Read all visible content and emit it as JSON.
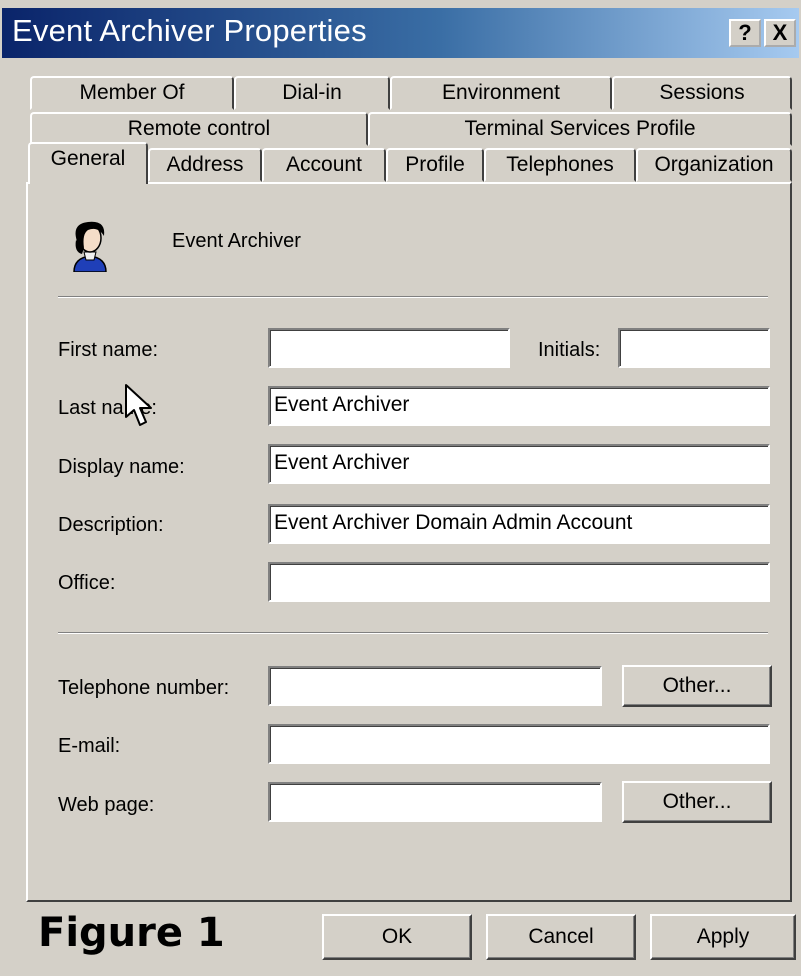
{
  "window": {
    "title": "Event Archiver Properties",
    "help_label": "?",
    "close_label": "X"
  },
  "tabs": {
    "row1": [
      "Member Of",
      "Dial-in",
      "Environment",
      "Sessions"
    ],
    "row2": [
      "Remote control",
      "Terminal Services Profile"
    ],
    "row3": [
      "General",
      "Address",
      "Account",
      "Profile",
      "Telephones",
      "Organization"
    ],
    "selected": "General"
  },
  "general": {
    "display_heading": "Event Archiver",
    "first_name_label": "First name:",
    "first_name_value": "",
    "initials_label": "Initials:",
    "initials_value": "",
    "last_name_label": "Last name:",
    "last_name_value": "Event Archiver",
    "display_name_label": "Display name:",
    "display_name_value": "Event Archiver",
    "description_label": "Description:",
    "description_value": "Event Archiver Domain Admin Account",
    "office_label": "Office:",
    "office_value": "",
    "telephone_label": "Telephone number:",
    "telephone_value": "",
    "email_label": "E-mail:",
    "email_value": "",
    "webpage_label": "Web page:",
    "webpage_value": "",
    "other_button_label": "Other..."
  },
  "footer": {
    "figure_label": "Figure 1",
    "ok_label": "OK",
    "cancel_label": "Cancel",
    "apply_label": "Apply"
  },
  "icons": [
    "user-icon",
    "mouse-cursor-icon"
  ]
}
